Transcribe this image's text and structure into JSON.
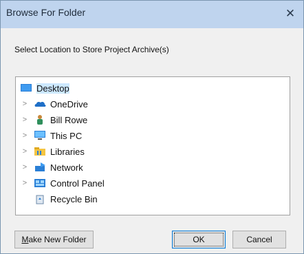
{
  "window": {
    "title": "Browse For Folder",
    "close_glyph": "✕"
  },
  "instruction": "Select Location to Store Project Archive(s)",
  "tree": {
    "items": [
      {
        "label": "Desktop",
        "icon": "desktop-icon",
        "expandable": false,
        "selected": true
      },
      {
        "label": "OneDrive",
        "icon": "onedrive-cloud-icon",
        "expandable": true
      },
      {
        "label": "Bill Rowe",
        "icon": "user-icon",
        "expandable": true
      },
      {
        "label": "This PC",
        "icon": "computer-icon",
        "expandable": true
      },
      {
        "label": "Libraries",
        "icon": "libraries-folder-icon",
        "expandable": true
      },
      {
        "label": "Network",
        "icon": "network-icon",
        "expandable": true
      },
      {
        "label": "Control Panel",
        "icon": "control-panel-icon",
        "expandable": true
      },
      {
        "label": "Recycle Bin",
        "icon": "recycle-bin-icon",
        "expandable": false
      }
    ],
    "expander_glyph": ">"
  },
  "buttons": {
    "make_new_folder_accel": "M",
    "make_new_folder_rest": "ake New Folder",
    "ok": "OK",
    "cancel": "Cancel"
  },
  "colors": {
    "titlebar": "#bfd4ee",
    "selection": "#cce8ff",
    "default_button_border": "#0078d7"
  }
}
